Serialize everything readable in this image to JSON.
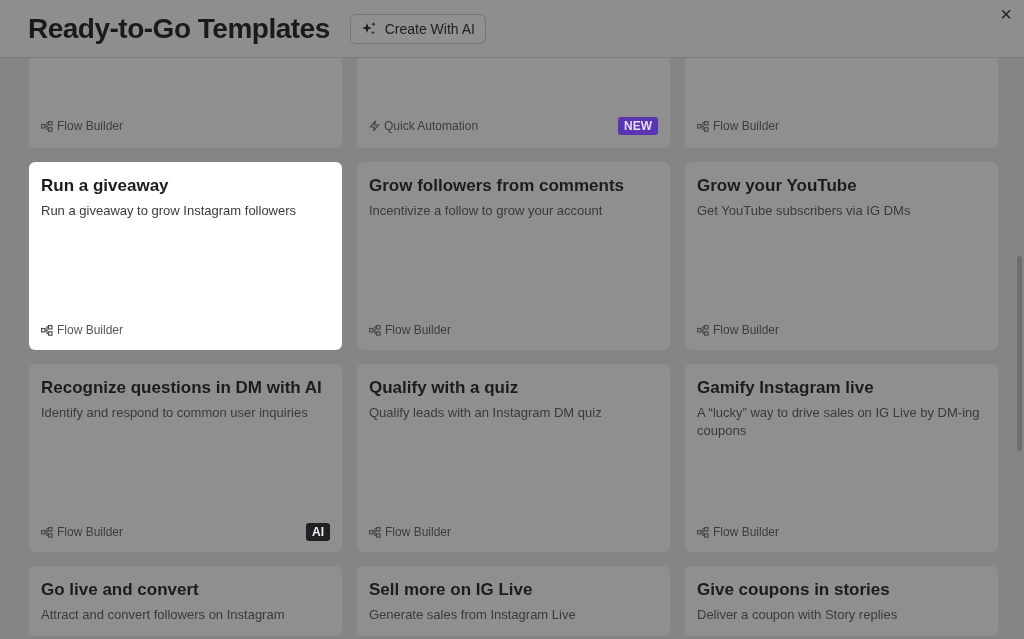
{
  "header": {
    "title": "Ready-to-Go Templates",
    "ai_button": "Create With AI",
    "close": "×"
  },
  "templates": [
    {
      "footer": {
        "kind": "flow",
        "text": "Flow Builder"
      },
      "selected": false
    },
    {
      "footer": {
        "kind": "quick",
        "text": "Quick Automation"
      },
      "badge": {
        "kind": "new",
        "text": "NEW"
      },
      "selected": false
    },
    {
      "footer": {
        "kind": "flow",
        "text": "Flow Builder"
      },
      "selected": false
    },
    {
      "title": "Run a giveaway",
      "description": "Run a giveaway to grow Instagram followers",
      "footer": {
        "kind": "flow",
        "text": "Flow Builder"
      },
      "selected": true
    },
    {
      "title": "Grow followers from comments",
      "description": "Incentivize a follow to grow your account",
      "footer": {
        "kind": "flow",
        "text": "Flow Builder"
      },
      "selected": false
    },
    {
      "title": "Grow your YouTube",
      "description": "Get YouTube subscribers via IG DMs",
      "footer": {
        "kind": "flow",
        "text": "Flow Builder"
      },
      "selected": false
    },
    {
      "title": "Recognize questions in DM with AI",
      "description": "Identify and respond to common user inquiries",
      "footer": {
        "kind": "flow",
        "text": "Flow Builder"
      },
      "badge": {
        "kind": "ai",
        "text": "AI"
      },
      "selected": false
    },
    {
      "title": "Qualify with a quiz",
      "description": "Qualify leads with an Instagram DM quiz",
      "footer": {
        "kind": "flow",
        "text": "Flow Builder"
      },
      "selected": false
    },
    {
      "title": "Gamify Instagram live",
      "description": "A “lucky” way to drive sales on IG Live by DM-ing coupons",
      "footer": {
        "kind": "flow",
        "text": "Flow Builder"
      },
      "selected": false
    },
    {
      "title": "Go live and convert",
      "description": "Attract and convert followers on Instagram",
      "selected": false
    },
    {
      "title": "Sell more on IG Live",
      "description": "Generate sales from Instagram Live",
      "selected": false
    },
    {
      "title": "Give coupons in stories",
      "description": "Deliver a coupon with Story replies",
      "selected": false
    }
  ]
}
